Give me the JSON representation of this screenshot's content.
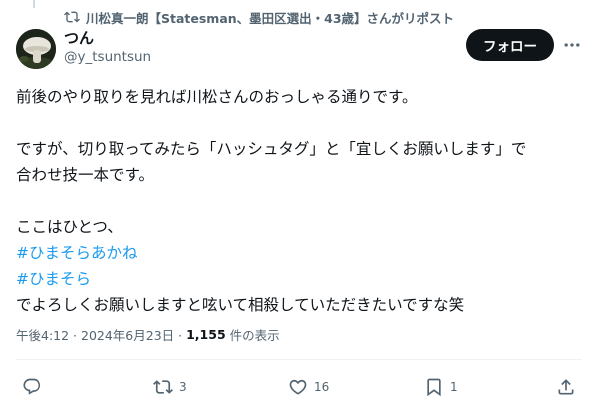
{
  "repost": {
    "icon": "repost-icon",
    "text": "川松真一朗【Statesman、墨田区選出・43歳】さんがリポスト"
  },
  "author": {
    "display_name": "つん",
    "handle": "@y_tsuntsun",
    "avatar": "avatar-mushroom"
  },
  "follow_label": "フォロー",
  "more_icon": "more-dots-icon",
  "body": {
    "line1": "前後のやり取りを見れば川松さんのおっしゃる通りです。",
    "line2": "ですが、切り取ってみたら「ハッシュタグ」と「宜しくお願いします」で",
    "line3": "合わせ技一本です。",
    "line4": "ここはひとつ、",
    "hashtag1": "#ひまそらあかね",
    "hashtag2": "#ひまそら",
    "line5": "でよろしくお願いしますと呟いて相殺していただきたいですな笑"
  },
  "meta": {
    "time": "午後4:12 · 2024年6月23日 · ",
    "views": "1,155",
    "views_label": "件の表示"
  },
  "actions": {
    "reply": {
      "icon": "reply-icon"
    },
    "retweet": {
      "icon": "retweet-icon",
      "count": "3"
    },
    "like": {
      "icon": "heart-icon",
      "count": "16"
    },
    "bookmark": {
      "icon": "bookmark-icon",
      "count": "1"
    },
    "share": {
      "icon": "share-icon"
    }
  },
  "colors": {
    "text": "#0f1419",
    "secondary": "#536471",
    "link": "#1d9bf0",
    "button_bg": "#0f1419"
  }
}
